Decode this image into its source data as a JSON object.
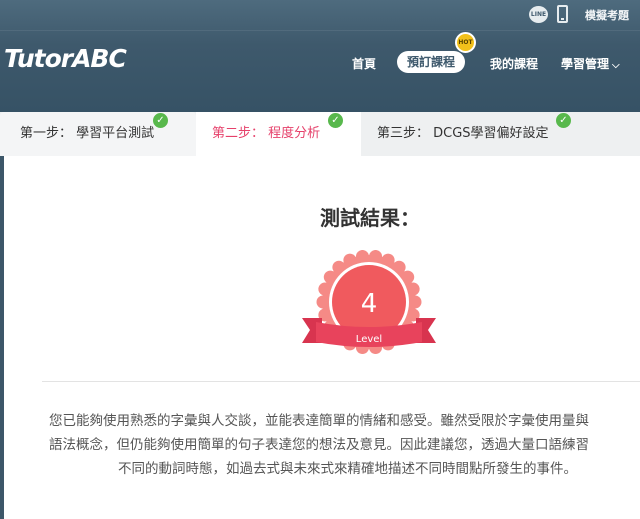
{
  "topbar": {
    "line_label": "LINE",
    "mock_exam": "模擬考題"
  },
  "brand": {
    "logo_text": "TutorABC"
  },
  "nav": {
    "home": "首頁",
    "book": "預訂課程",
    "badge": "HOT",
    "my_courses": "我的課程",
    "manage": "學習管理",
    "manage_chevron": "⌵"
  },
  "tabs": [
    {
      "label": "第一步： 學習平台測試",
      "completed": true,
      "active": false
    },
    {
      "label": "第二步： 程度分析",
      "completed": true,
      "active": true
    },
    {
      "label": "第三步： DCGS學習偏好設定",
      "completed": true,
      "active": false
    }
  ],
  "result": {
    "title": "測試結果：",
    "level_number": "4",
    "level_label": "Level"
  },
  "description": {
    "line1": "您已能夠使用熟悉的字彙與人交談，並能表達簡單的情緒和感受。雖然受限於字彙使用量與",
    "line2": "語法概念，但仍能夠使用簡單的句子表達您的想法及意見。因此建議您，透過大量口語練習",
    "line3": "不同的動詞時態，如過去式與未來式來精確地描述不同時間點所發生的事件。"
  },
  "colors": {
    "header": "#3e596c",
    "accent_pink": "#e6416b",
    "badge_red": "#f0545e",
    "ribbon": "#e4405a",
    "check_green": "#58b84c",
    "hot_yellow": "#f2c11b"
  }
}
